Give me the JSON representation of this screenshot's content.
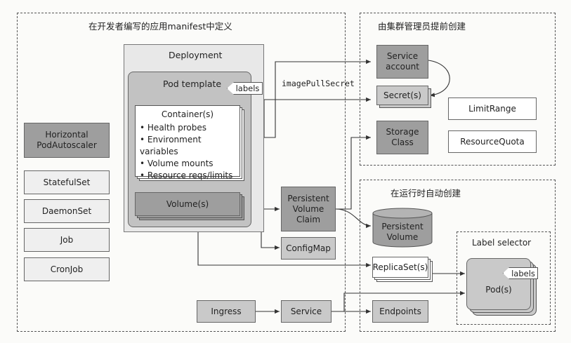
{
  "regions": {
    "manifest": "在开发者编写的应用manifest中定义",
    "admin": "由集群管理员提前创建",
    "runtime": "在运行时自动创建",
    "label_selector": "Label selector"
  },
  "deployment": {
    "title": "Deployment",
    "pod_template": "Pod template",
    "labels": "labels",
    "container_title": "Container(s)",
    "container_items": [
      "Health probes",
      "Environment variables",
      "Volume mounts",
      "Resource reqs/limits"
    ],
    "volumes": "Volume(s)"
  },
  "left": {
    "hpa": "Horizontal PodAutoscaler",
    "statefulset": "StatefulSet",
    "daemonset": "DaemonSet",
    "job": "Job",
    "cronjob": "CronJob"
  },
  "middle": {
    "pvc": "Persistent Volume Claim",
    "configmap": "ConfigMap",
    "ingress": "Ingress",
    "service": "Service"
  },
  "admin_items": {
    "service_account": "Service account",
    "secrets": "Secret(s)",
    "storage_class": "Storage Class",
    "limit_range": "LimitRange",
    "resource_quota": "ResourceQuota"
  },
  "edge_labels": {
    "image_pull_secret": "imagePullSecret"
  },
  "runtime_items": {
    "persistent_volume": "Persistent Volume",
    "replicasets": "ReplicaSet(s)",
    "pods": "Pod(s)",
    "pod_labels": "labels",
    "endpoints": "Endpoints"
  }
}
